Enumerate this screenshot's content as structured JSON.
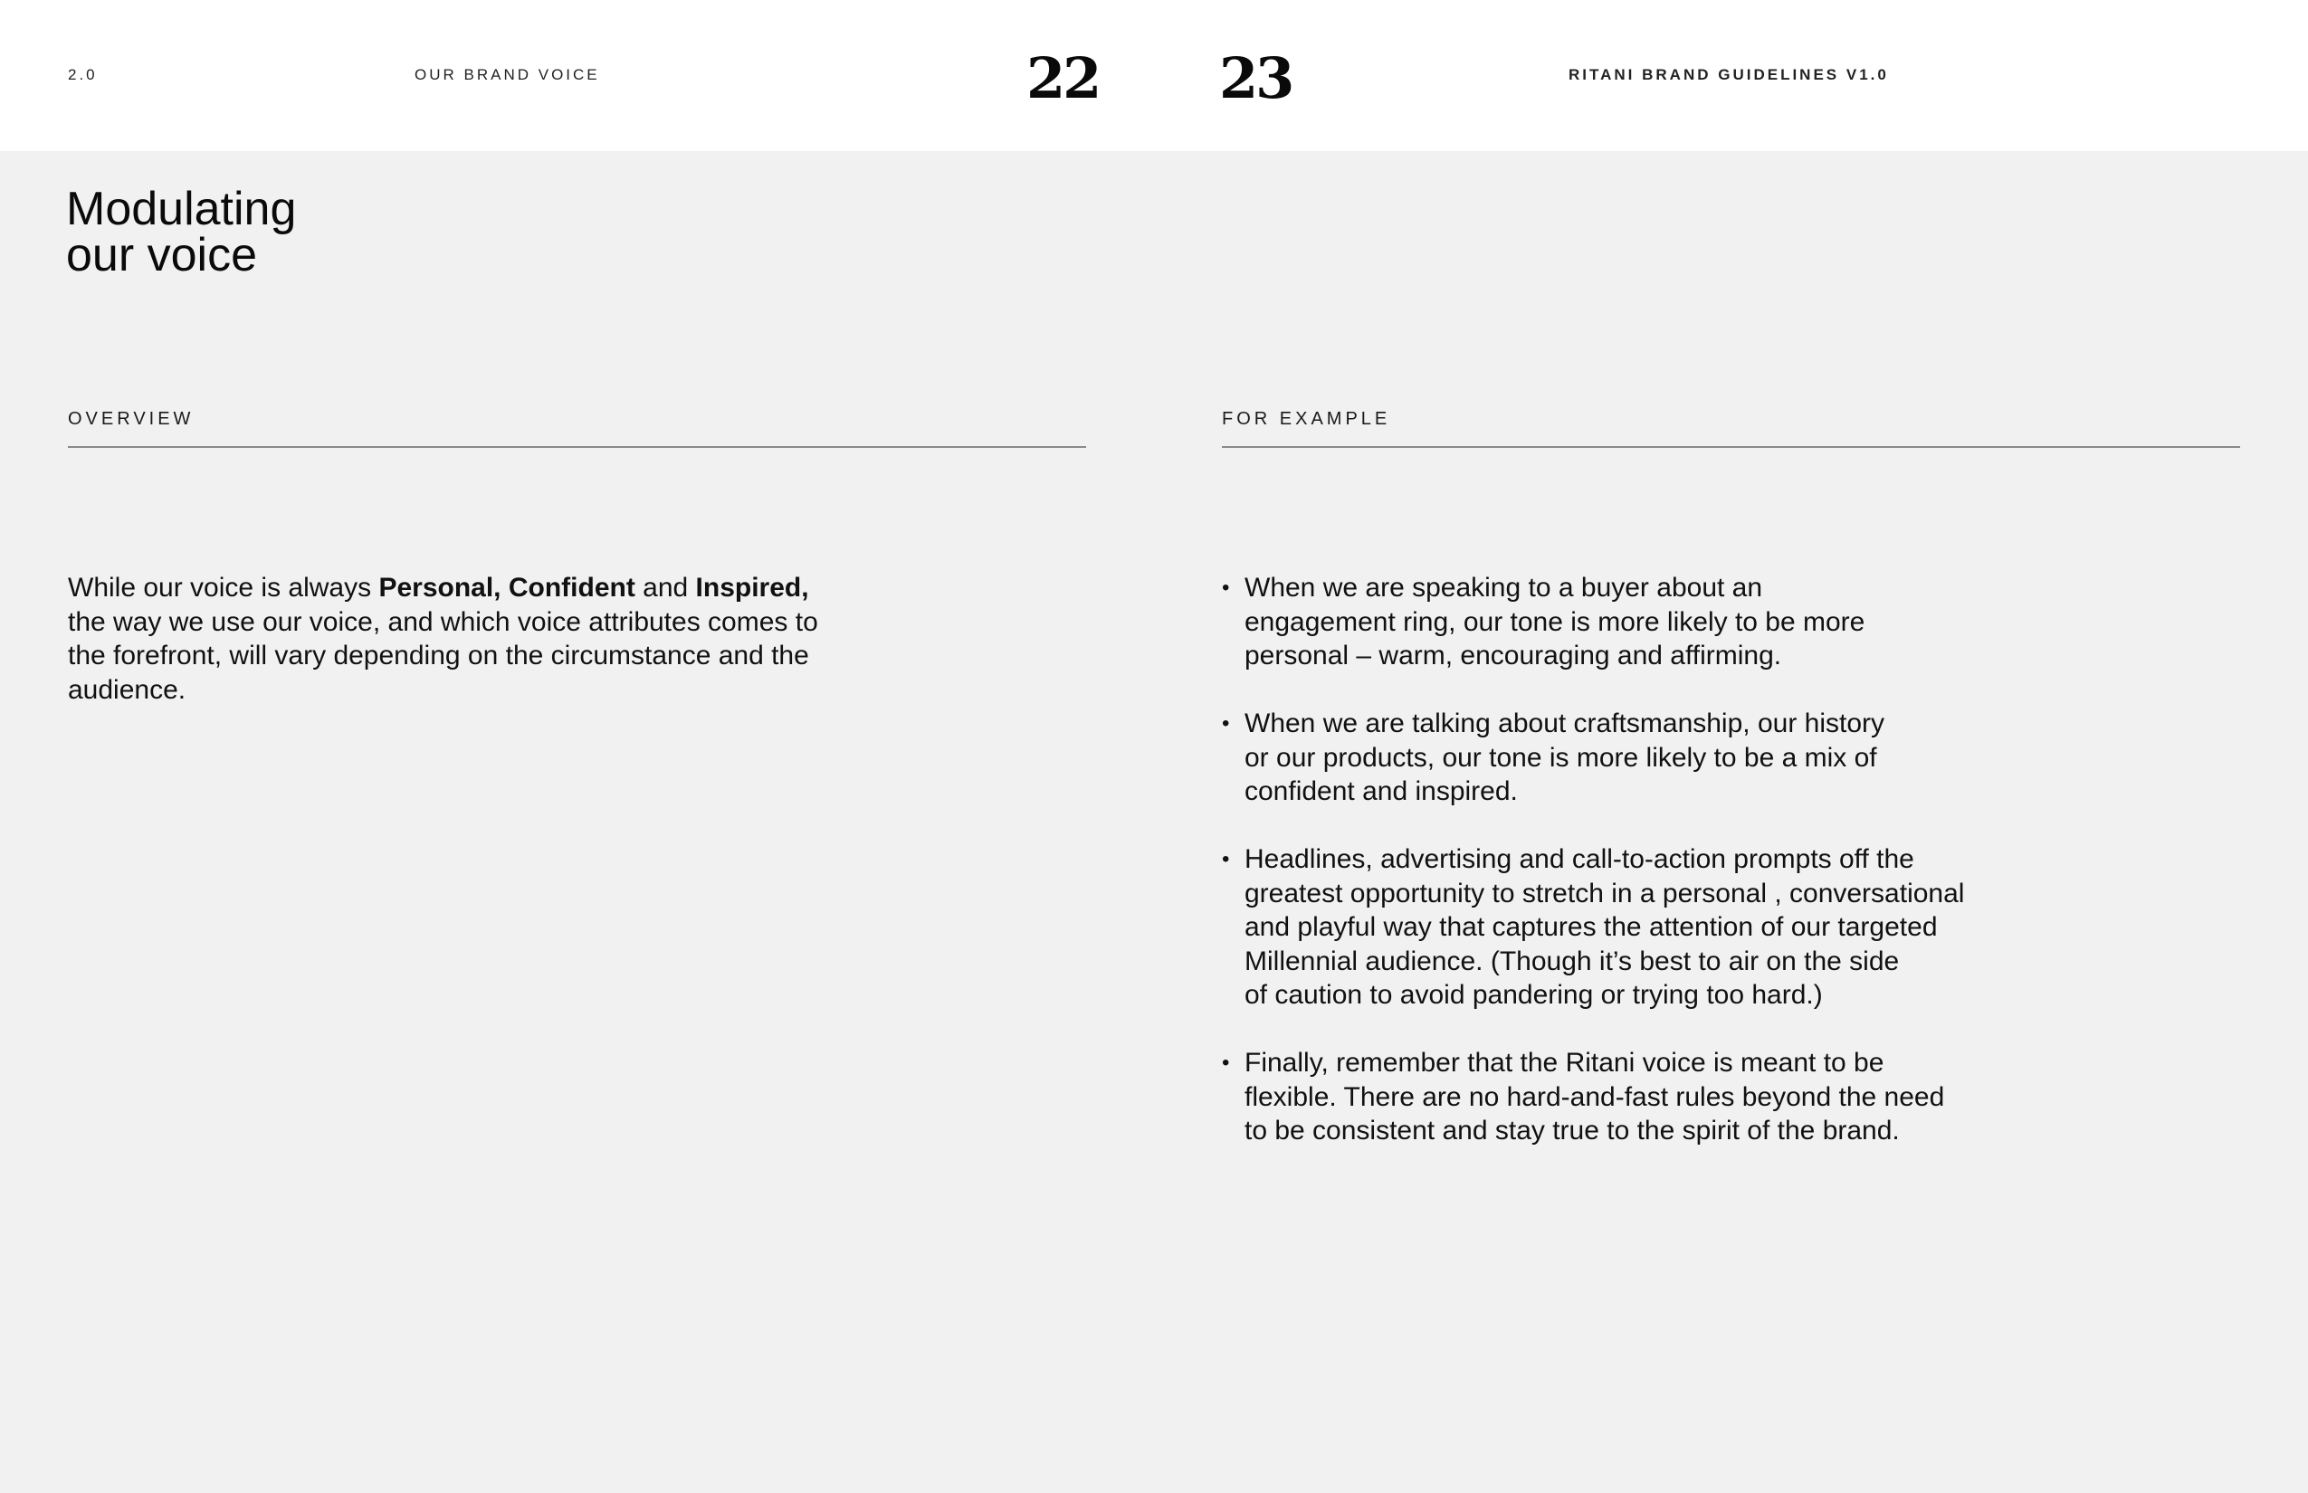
{
  "header": {
    "section_number": "2.0",
    "section_title": "OUR BRAND VOICE",
    "page_left": "22",
    "page_right": "23",
    "document_title": "RITANI BRAND GUIDELINES V1.0"
  },
  "headline": {
    "line1": "Modulating",
    "line2": "our voice"
  },
  "overview": {
    "label": "OVERVIEW",
    "text_1": "While our voice is always ",
    "bold_1": "Personal, Confident",
    "text_2": " and ",
    "bold_2": "Inspired,",
    "text_3": "the way we use our voice, and which voice attributes comes to the forefront, will vary depending on the circumstance and the audience."
  },
  "examples": {
    "label": "FOR EXAMPLE",
    "bullet_symbol": "•",
    "items": [
      "When we are speaking to a buyer about an\nengagement ring, our tone is more likely to be more\npersonal – warm, encouraging and affirming.",
      "When we are talking about craftsmanship, our history\nor our products, our tone is more likely to be a mix of\nconfident and inspired.",
      "Headlines, advertising and call-to-action prompts off the\ngreatest opportunity to stretch in a personal , conversational\nand playful way that captures the attention of our targeted\nMillennial audience. (Though it’s best to air on the side\nof caution to avoid pandering or trying too hard.)",
      "Finally, remember that the Ritani voice is meant to be\nflexible. There are no hard-and-fast rules beyond the need\nto be consistent and stay true to the spirit of the brand."
    ]
  },
  "colors": {
    "background": "#f1f1f1",
    "header_background": "#ffffff",
    "text": "#111111",
    "rule": "#8a8a8a"
  }
}
